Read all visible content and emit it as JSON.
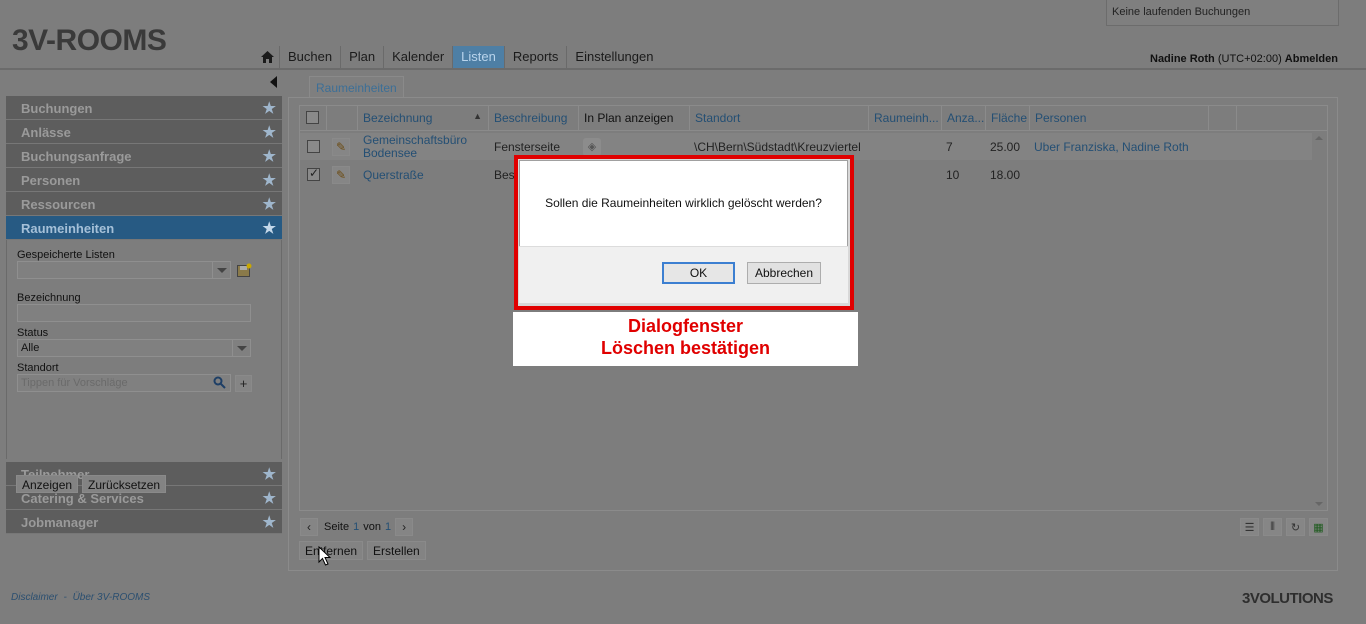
{
  "app": {
    "logo": "3V-ROOMS",
    "booking_status": "Keine laufenden Buchungen",
    "user_name": "Nadine Roth",
    "timezone": "(UTC+02:00)",
    "logout": "Abmelden"
  },
  "nav": {
    "items": [
      "Buchen",
      "Plan",
      "Kalender",
      "Listen",
      "Reports",
      "Einstellungen"
    ],
    "active": "Listen"
  },
  "sidebar": {
    "sections_top": [
      "Buchungen",
      "Anlässe",
      "Buchungsanfrage",
      "Personen",
      "Ressourcen"
    ],
    "active": "Raumeinheiten",
    "sections_bottom": [
      "Teilnehmer",
      "Catering & Services",
      "Jobmanager"
    ],
    "filter": {
      "saved_lists_label": "Gespeicherte Listen",
      "saved_lists_value": "",
      "name_label": "Bezeichnung",
      "name_value": "",
      "status_label": "Status",
      "status_value": "Alle",
      "location_label": "Standort",
      "location_placeholder": "Tippen für Vorschläge",
      "show_button": "Anzeigen",
      "reset_button": "Zurücksetzen"
    }
  },
  "main": {
    "tab": "Raumeinheiten",
    "columns": [
      "Bezeichnung",
      "Beschreibung",
      "In Plan anzeigen",
      "Standort",
      "Raumeinh...",
      "Anza...",
      "Fläche",
      "Personen"
    ],
    "rows": [
      {
        "name": "Gemeinschaftsbüro Bodensee",
        "description": "Fensterseite",
        "location": "\\CH\\Bern\\Südstadt\\Kreuzviertel",
        "count": "7",
        "area": "25.00",
        "persons": "Uber Franziska, Nadine Roth",
        "checked": false
      },
      {
        "name": "Querstraße",
        "description": "Bes",
        "location": "",
        "count": "10",
        "area": "18.00",
        "persons": "",
        "checked": true
      }
    ],
    "pager": {
      "page_label": "Seite",
      "page": "1",
      "of_label": "von",
      "total": "1"
    },
    "remove_button": "Entfernen",
    "create_button": "Erstellen"
  },
  "dialog": {
    "message": "Sollen die Raumeinheiten wirklich gelöscht werden?",
    "ok": "OK",
    "cancel": "Abbrechen",
    "caption_line1": "Dialogfenster",
    "caption_line2": "Löschen bestätigen"
  },
  "footer": {
    "disclaimer": "Disclaimer",
    "separator": "-",
    "about": "Über 3V-ROOMS",
    "logo": "3VOLUTIONS"
  },
  "colors": {
    "accent": "#275a83",
    "dialog_highlight": "#e00000",
    "link": "#244f74"
  }
}
